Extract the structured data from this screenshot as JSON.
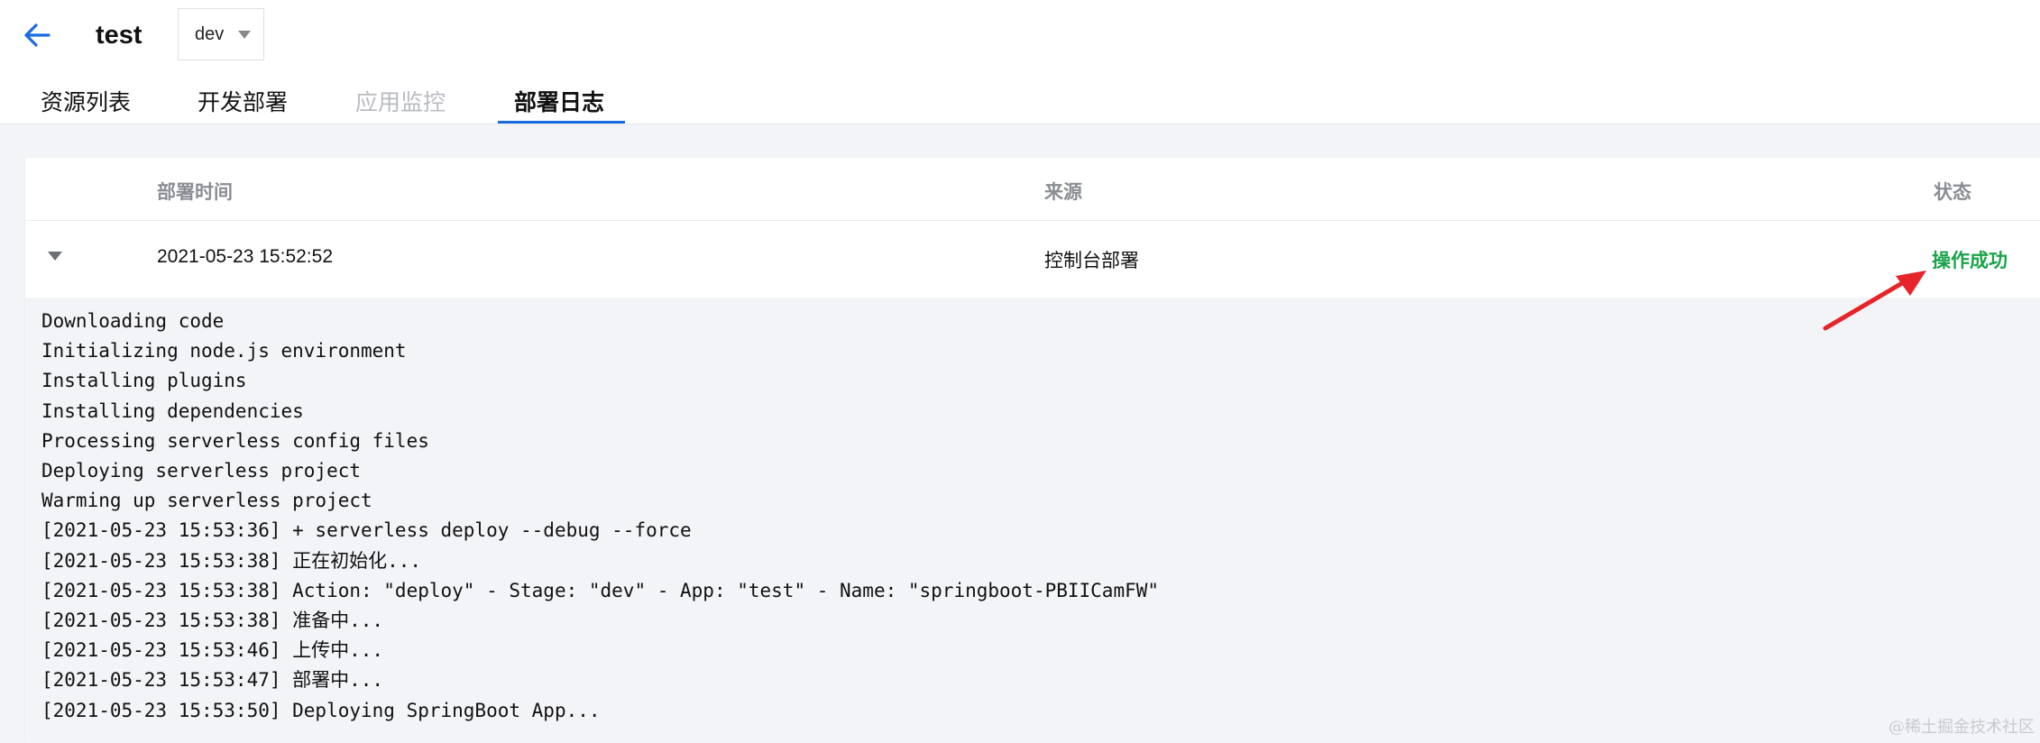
{
  "header": {
    "title": "test",
    "env_selected": "dev",
    "tabs": [
      {
        "label": "资源列表"
      },
      {
        "label": "开发部署"
      },
      {
        "label": "应用监控"
      },
      {
        "label": "部署日志"
      }
    ],
    "active_tab_index": 3
  },
  "table": {
    "columns": [
      "部署时间",
      "来源",
      "状态"
    ],
    "rows": [
      {
        "time": "2021-05-23 15:52:52",
        "source": "控制台部署",
        "status": "操作成功"
      }
    ]
  },
  "log_lines": [
    "Downloading code",
    "Initializing node.js environment",
    "Installing plugins",
    "Installing dependencies",
    "Processing serverless config files",
    "Deploying serverless project",
    "Warming up serverless project",
    "[2021-05-23 15:53:36] + serverless deploy --debug --force",
    "[2021-05-23 15:53:38] 正在初始化...",
    "[2021-05-23 15:53:38] Action: \"deploy\" - Stage: \"dev\" - App: \"test\" - Name: \"springboot-PBIICamFW\"",
    "[2021-05-23 15:53:38] 准备中...",
    "[2021-05-23 15:53:46] 上传中...",
    "[2021-05-23 15:53:47] 部署中...",
    "[2021-05-23 15:53:50] Deploying SpringBoot App..."
  ],
  "watermark": "@稀土掘金技术社区",
  "colors": {
    "accent": "#1a6be0",
    "success": "#1aa34a",
    "annotation_arrow": "#e5252a"
  },
  "icons": {
    "back": "arrow-left-icon",
    "select": "caret-down-icon",
    "expand": "caret-down-icon",
    "annotation": "red-arrow-icon"
  }
}
